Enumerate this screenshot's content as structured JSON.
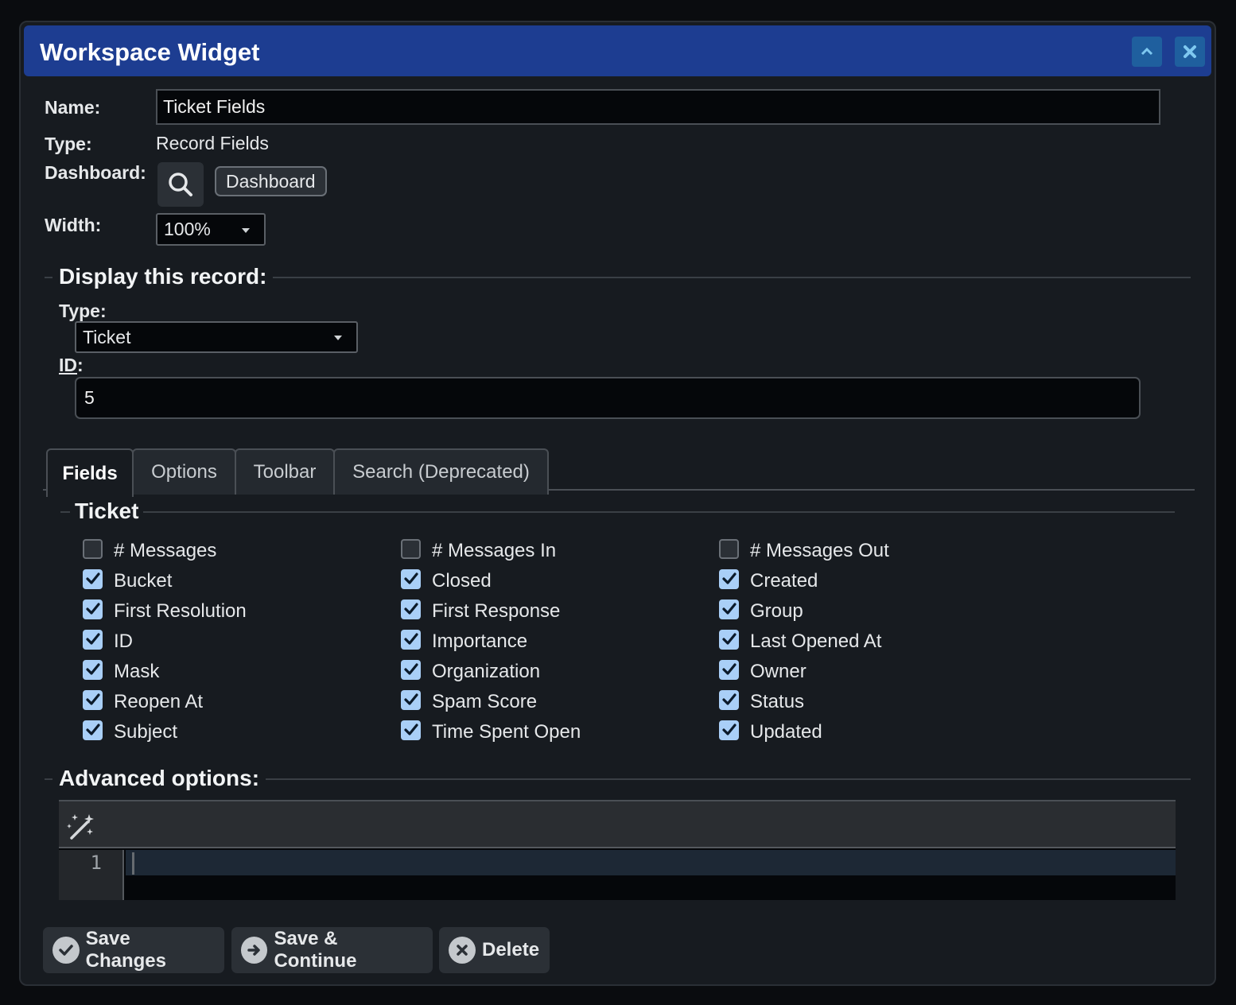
{
  "window": {
    "title": "Workspace Widget",
    "collapse_icon": "chevron-up-icon",
    "close_icon": "close-icon"
  },
  "form": {
    "name_label": "Name:",
    "name_value": "Ticket Fields",
    "type_label": "Type:",
    "type_value": "Record Fields",
    "dashboard_label": "Dashboard:",
    "dashboard_chip": "Dashboard",
    "width_label": "Width:",
    "width_value": "100%"
  },
  "display_record": {
    "legend": "Display this record:",
    "type_label": "Type:",
    "type_value": "Ticket",
    "id_label": "ID",
    "id_colon": ":",
    "id_value": "5"
  },
  "tabs": [
    {
      "label": "Fields",
      "active": true
    },
    {
      "label": "Options",
      "active": false
    },
    {
      "label": "Toolbar",
      "active": false
    },
    {
      "label": "Search (Deprecated)",
      "active": false
    }
  ],
  "fields_panel": {
    "legend": "Ticket",
    "fields": [
      {
        "label": "# Messages",
        "checked": false
      },
      {
        "label": "# Messages In",
        "checked": false
      },
      {
        "label": "# Messages Out",
        "checked": false
      },
      {
        "label": "Bucket",
        "checked": true
      },
      {
        "label": "Closed",
        "checked": true
      },
      {
        "label": "Created",
        "checked": true
      },
      {
        "label": "First Resolution",
        "checked": true
      },
      {
        "label": "First Response",
        "checked": true
      },
      {
        "label": "Group",
        "checked": true
      },
      {
        "label": "ID",
        "checked": true
      },
      {
        "label": "Importance",
        "checked": true
      },
      {
        "label": "Last Opened At",
        "checked": true
      },
      {
        "label": "Mask",
        "checked": true
      },
      {
        "label": "Organization",
        "checked": true
      },
      {
        "label": "Owner",
        "checked": true
      },
      {
        "label": "Reopen At",
        "checked": true
      },
      {
        "label": "Spam Score",
        "checked": true
      },
      {
        "label": "Status",
        "checked": true
      },
      {
        "label": "Subject",
        "checked": true
      },
      {
        "label": "Time Spent Open",
        "checked": true
      },
      {
        "label": "Updated",
        "checked": true
      }
    ]
  },
  "advanced": {
    "legend": "Advanced options:",
    "toolbar_icon": "magic-wand-icon",
    "line_number": "1",
    "content": ""
  },
  "actions": {
    "save_label": "Save Changes",
    "save_continue_label": "Save & Continue",
    "delete_label": "Delete"
  },
  "colors": {
    "titlebar": "#1d3d91",
    "background": "#171b20",
    "checkbox_checked": "#a9cff7"
  }
}
